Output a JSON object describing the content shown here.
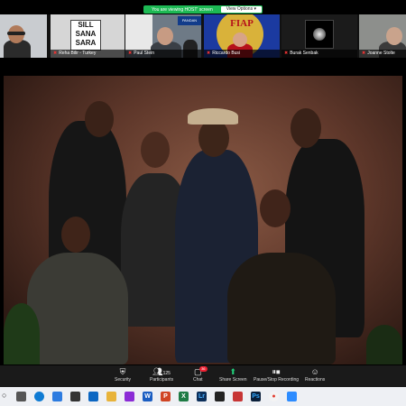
{
  "notice": {
    "message": "You are viewing HOST' screen",
    "view_options": "View Options ▾"
  },
  "participants": [
    {
      "name": ""
    },
    {
      "name": "Reha Bilir - Turkey"
    },
    {
      "name": "Paul Stein"
    },
    {
      "name": "Riccardo Busi"
    },
    {
      "name": "Burak Senbak"
    },
    {
      "name": "Joanne Stolte"
    }
  ],
  "tile_texts": {
    "sill_line1": "SILL",
    "sill_line2": "SANA",
    "sill_line3": "SARA",
    "fiap": "FIAP",
    "pandan": "PANDAN"
  },
  "controls": {
    "security": "Security",
    "participants": "Participants",
    "participants_count": "125",
    "chat": "Chat",
    "chat_badge": "36",
    "share_screen": "Share Screen",
    "recording": "Pause/Stop Recording",
    "reactions": "Reactions"
  },
  "taskbar": {
    "search_glyph": "○",
    "word": "W",
    "excel": "X",
    "powerpoint": "P",
    "lightroom": "Lr",
    "photoshop": "Ps",
    "chrome": "●"
  }
}
